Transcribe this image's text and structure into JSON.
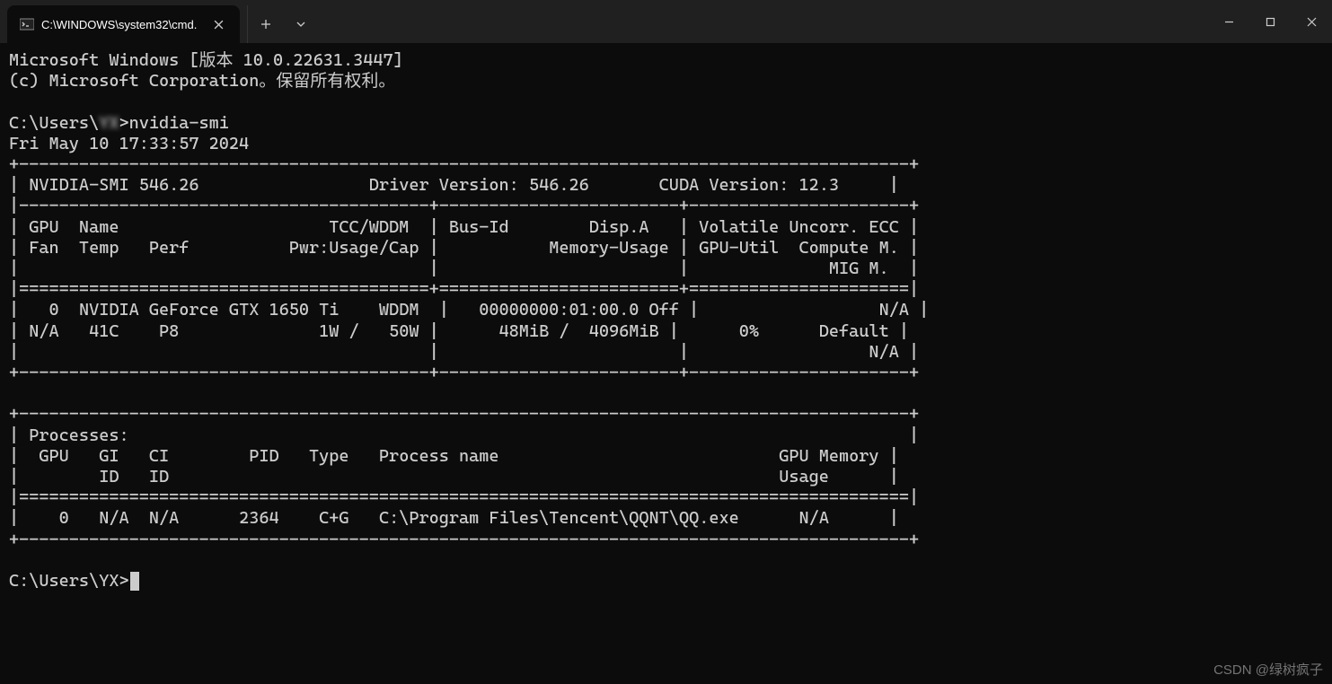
{
  "window": {
    "tab_title": "C:\\WINDOWS\\system32\\cmd."
  },
  "terminal": {
    "header_line1": "Microsoft Windows [版本 10.0.22631.3447]",
    "header_line2": "(c) Microsoft Corporation。保留所有权利。",
    "prompt1_path": "C:\\Users\\",
    "prompt1_user_blurred": "YX",
    "prompt1_sep": ">",
    "command1": "nvidia-smi",
    "timestamp": "Fri May 10 17:33:57 2024",
    "smi": {
      "smi_version": "NVIDIA-SMI 546.26",
      "driver_version_label": "Driver Version:",
      "driver_version": "546.26",
      "cuda_version_label": "CUDA Version:",
      "cuda_version": "12.3",
      "headers": {
        "col1_l1": "GPU  Name                     TCC/WDDM",
        "col1_l2": "Fan  Temp   Perf          Pwr:Usage/Cap",
        "col2_l1": "Bus-Id        Disp.A",
        "col2_l2": "Memory-Usage",
        "col3_l1": "Volatile Uncorr. ECC",
        "col3_l2": "GPU-Util  Compute M.",
        "col3_l3": "MIG M."
      },
      "gpu0": {
        "index": "0",
        "name": "NVIDIA GeForce GTX 1650 Ti",
        "mode": "WDDM",
        "bus_id": "00000000:01:00.0",
        "disp_a": "Off",
        "ecc": "N/A",
        "fan": "N/A",
        "temp": "41C",
        "perf": "P8",
        "pwr": "1W /   50W",
        "mem": "48MiB /  4096MiB",
        "util": "0%",
        "compute": "Default",
        "mig": "N/A"
      },
      "processes": {
        "title": "Processes:",
        "head_l1": "GPU   GI   CI        PID   Type   Process name                            GPU Memory",
        "head_l2": "ID   ID                                                             Usage",
        "row": {
          "gpu": "0",
          "gi": "N/A",
          "ci": "N/A",
          "pid": "2364",
          "type": "C+G",
          "name": "C:\\Program Files\\Tencent\\QQNT\\QQ.exe",
          "mem": "N/A"
        }
      }
    },
    "prompt2": "C:\\Users\\YX>"
  },
  "watermark": "CSDN @绿树疯子"
}
